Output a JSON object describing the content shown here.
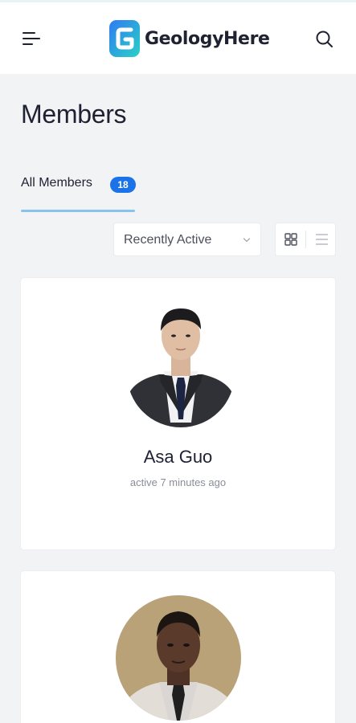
{
  "header": {
    "brand_name": "GeologyHere",
    "logo_letter": "G",
    "menu_icon": "hamburger-menu-icon",
    "search_icon": "search-icon",
    "brand_gradient": [
      "#2f7bf2",
      "#2ad1c7"
    ]
  },
  "page": {
    "title": "Members"
  },
  "tabs": [
    {
      "label": "All Members",
      "count": "18",
      "active": true
    }
  ],
  "toolbar": {
    "sort_selected": "Recently Active",
    "grid_view_icon": "grid-view-icon",
    "list_view_icon": "list-view-icon",
    "active_view": "grid"
  },
  "members": [
    {
      "name": "Asa Guo",
      "status": "active 7 minutes ago"
    },
    {
      "name": "",
      "status": ""
    }
  ],
  "colors": {
    "accent": "#1a73e8",
    "tab_underline": "#88c3ee",
    "background": "#f2f3f5"
  }
}
